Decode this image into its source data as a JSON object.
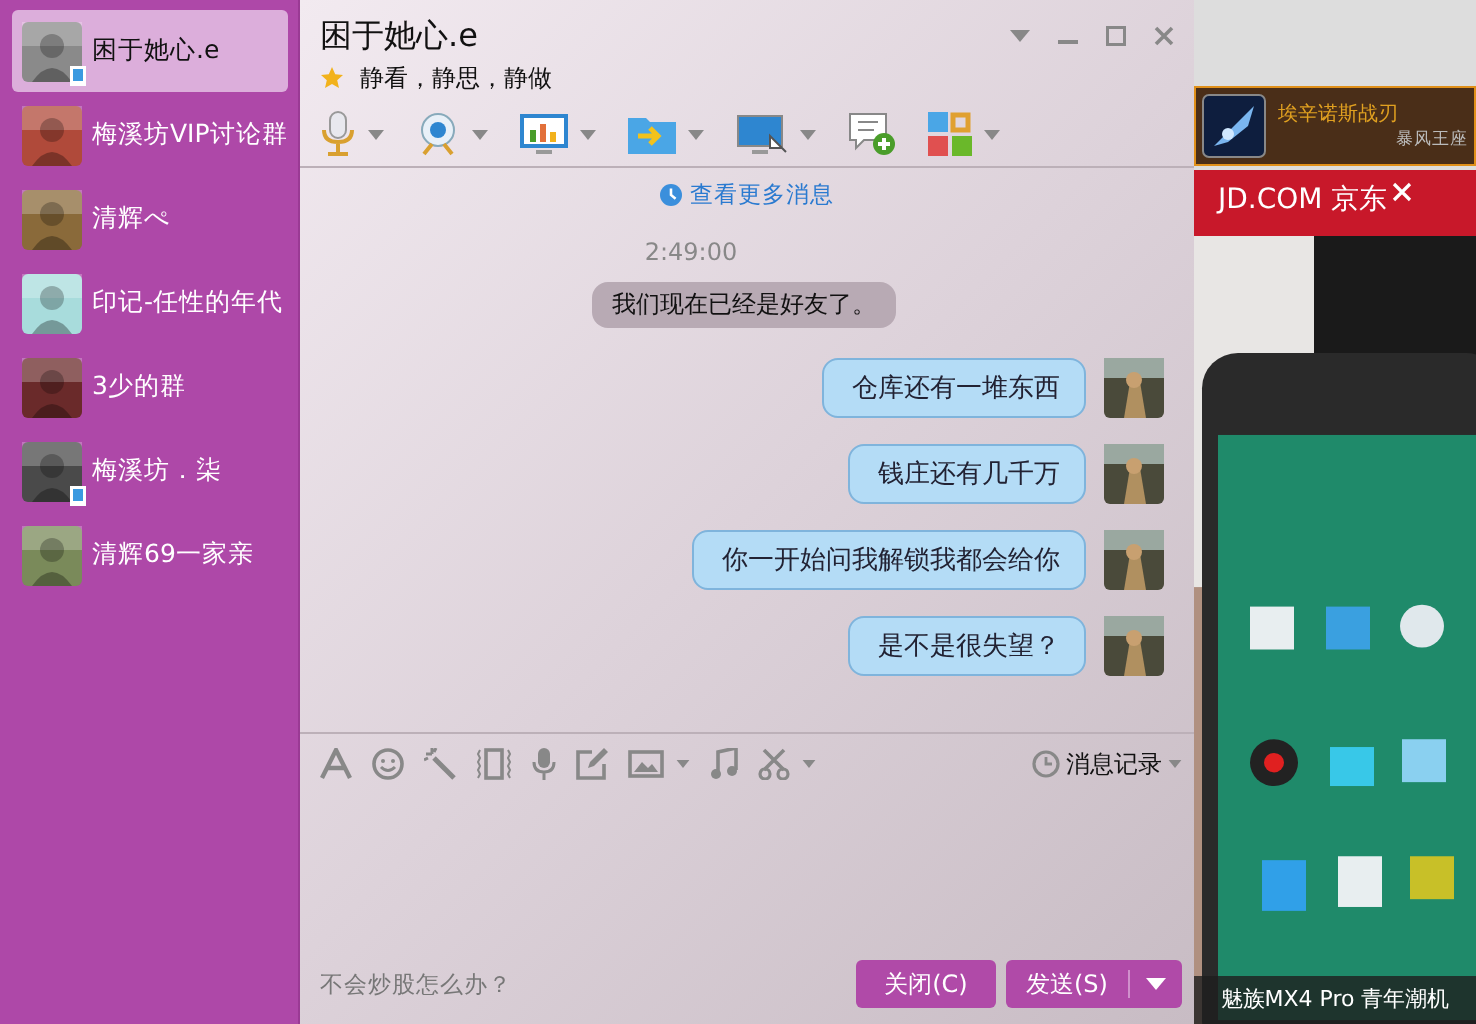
{
  "contacts": [
    {
      "name": "困于她心.e",
      "selected": true,
      "mobile": true,
      "color": "#8a8a8a"
    },
    {
      "name": "梅溪坊VIP讨论群",
      "selected": false,
      "mobile": false,
      "color": "#b04a3a"
    },
    {
      "name": "清辉ぺ",
      "selected": false,
      "mobile": false,
      "color": "#8a6a3a"
    },
    {
      "name": "印记-任性的年代",
      "selected": false,
      "mobile": false,
      "color": "#a8dcdc"
    },
    {
      "name": "3少的群",
      "selected": false,
      "mobile": false,
      "color": "#6a2a2a"
    },
    {
      "name": "梅溪坊．柒",
      "selected": false,
      "mobile": true,
      "color": "#4a4a4a"
    },
    {
      "name": "清辉69一家亲",
      "selected": false,
      "mobile": false,
      "color": "#7a8a5a"
    }
  ],
  "chat": {
    "title": "困于她心.e",
    "signature": "静看，静思，静做",
    "more_messages": "查看更多消息",
    "time": "2:49:00",
    "system_message": "我们现在已经是好友了。",
    "messages": [
      {
        "text": "仓库还有一堆东西"
      },
      {
        "text": "钱庄还有几千万"
      },
      {
        "text": "你一开始问我解锁我都会给你"
      },
      {
        "text": "是不是很失望？"
      }
    ],
    "history": "消息记录",
    "hint": "不会炒股怎么办？",
    "close_button": "关闭(C)",
    "send_button": "发送(S)"
  },
  "ad": {
    "game_title": "埃辛诺斯战刃",
    "game_subtitle": "暴风王座",
    "banner": "JD.COM 京东",
    "caption": "魅族MX4 Pro  青年潮机"
  }
}
